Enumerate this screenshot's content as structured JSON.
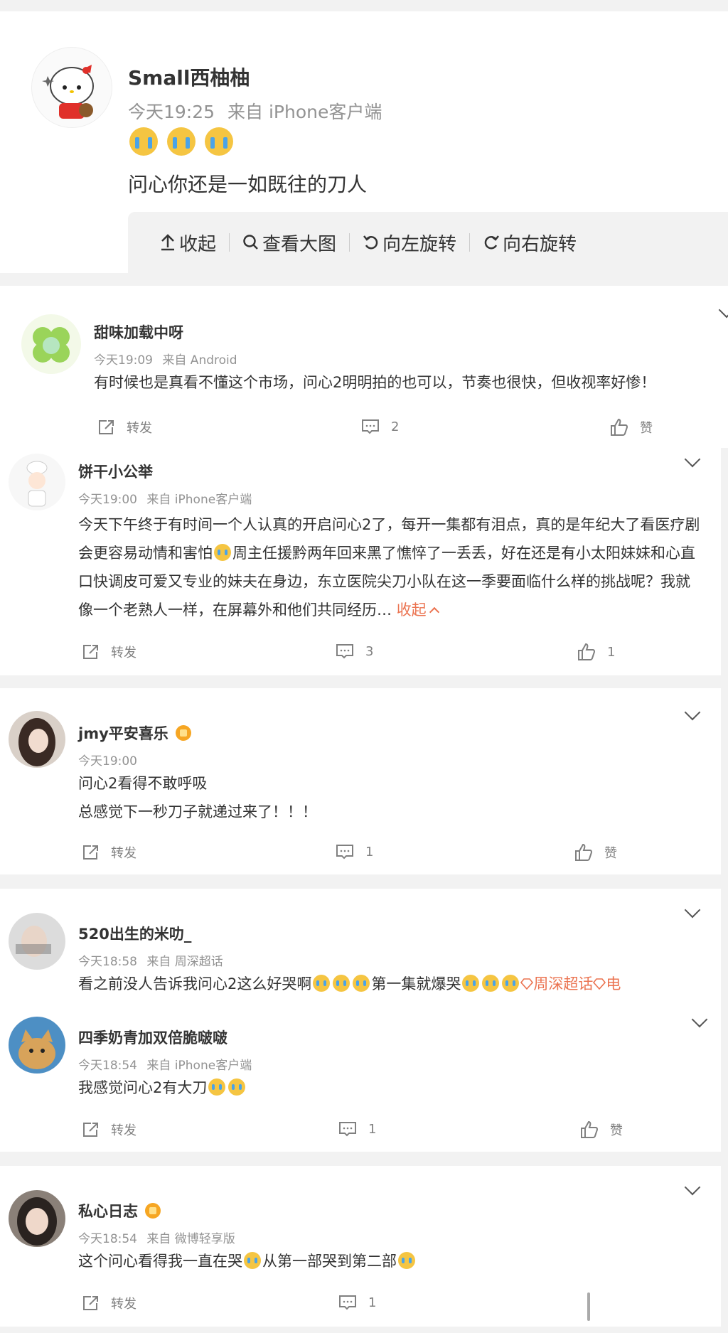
{
  "post": {
    "author": "Small西柚柚",
    "time": "今天19:25",
    "source": "来自 iPhone客户端",
    "text": "问心你还是一如既往的刀人",
    "toolbar": {
      "collapse": "收起",
      "view_large": "查看大图",
      "rotate_left": "向左旋转",
      "rotate_right": "向右旋转"
    }
  },
  "comments": [
    {
      "name": "甜味加载中呀",
      "time": "今天19:09",
      "source": "来自 Android",
      "text": "有时候也是真看不懂这个市场，问心2明明拍的也可以，节奏也很快，但收视率好惨！",
      "forward": "转发",
      "comments": "2",
      "like": "赞"
    },
    {
      "name": "饼干小公举",
      "time": "今天19:00",
      "source": "来自 iPhone客户端",
      "text_before": "今天下午终于有时间一个人认真的开启问心2了，每开一集都有泪点，真的是年纪大了看医疗剧会更容易动情和害怕",
      "text_after": "周主任援黔两年回来黑了憔悴了一丢丢，好在还是有小太阳妹妹和心直口快调皮可爱又专业的妹夫在身边，东立医院尖刀小队在这一季要面临什么样的挑战呢？我就像一个老熟人一样，在屏幕外和他们共同经历…",
      "collapse": "收起",
      "forward": "转发",
      "comments": "3",
      "like": "1"
    },
    {
      "name": "jmy平安喜乐",
      "time": "今天19:00",
      "line1": "问心2看得不敢呼吸",
      "line2": "总感觉下一秒刀子就递过来了！！！",
      "forward": "转发",
      "comments": "1",
      "like": "赞"
    },
    {
      "name": "520出生的米叻_",
      "time": "今天18:58",
      "source": "来自 周深超话",
      "text_before": "看之前没人告诉我问心2这么好哭啊",
      "text_middle": "第一集就爆哭",
      "topic": "周深超话",
      "topic_tail": "电"
    },
    {
      "name": "四季奶青加双倍脆啵啵",
      "time": "今天18:54",
      "source": "来自 iPhone客户端",
      "text": "我感觉问心2有大刀",
      "forward": "转发",
      "comments": "1",
      "like": "赞"
    },
    {
      "name": "私心日志",
      "time": "今天18:54",
      "source": "来自 微博轻享版",
      "text_a": "这个问心看得我一直在哭",
      "text_b": "从第一部哭到第二部",
      "forward": "转发",
      "comments": "1"
    }
  ],
  "colors": {
    "accent": "#eb7350",
    "meta": "#939393",
    "background": "#f2f2f2"
  },
  "icons": [
    "crying-emoji-icon",
    "share-icon",
    "comment-icon",
    "like-icon",
    "chevron-down-icon",
    "vip-badge-icon",
    "collapse-arrow-icon",
    "search-icon",
    "rotate-left-icon",
    "rotate-right-icon"
  ]
}
